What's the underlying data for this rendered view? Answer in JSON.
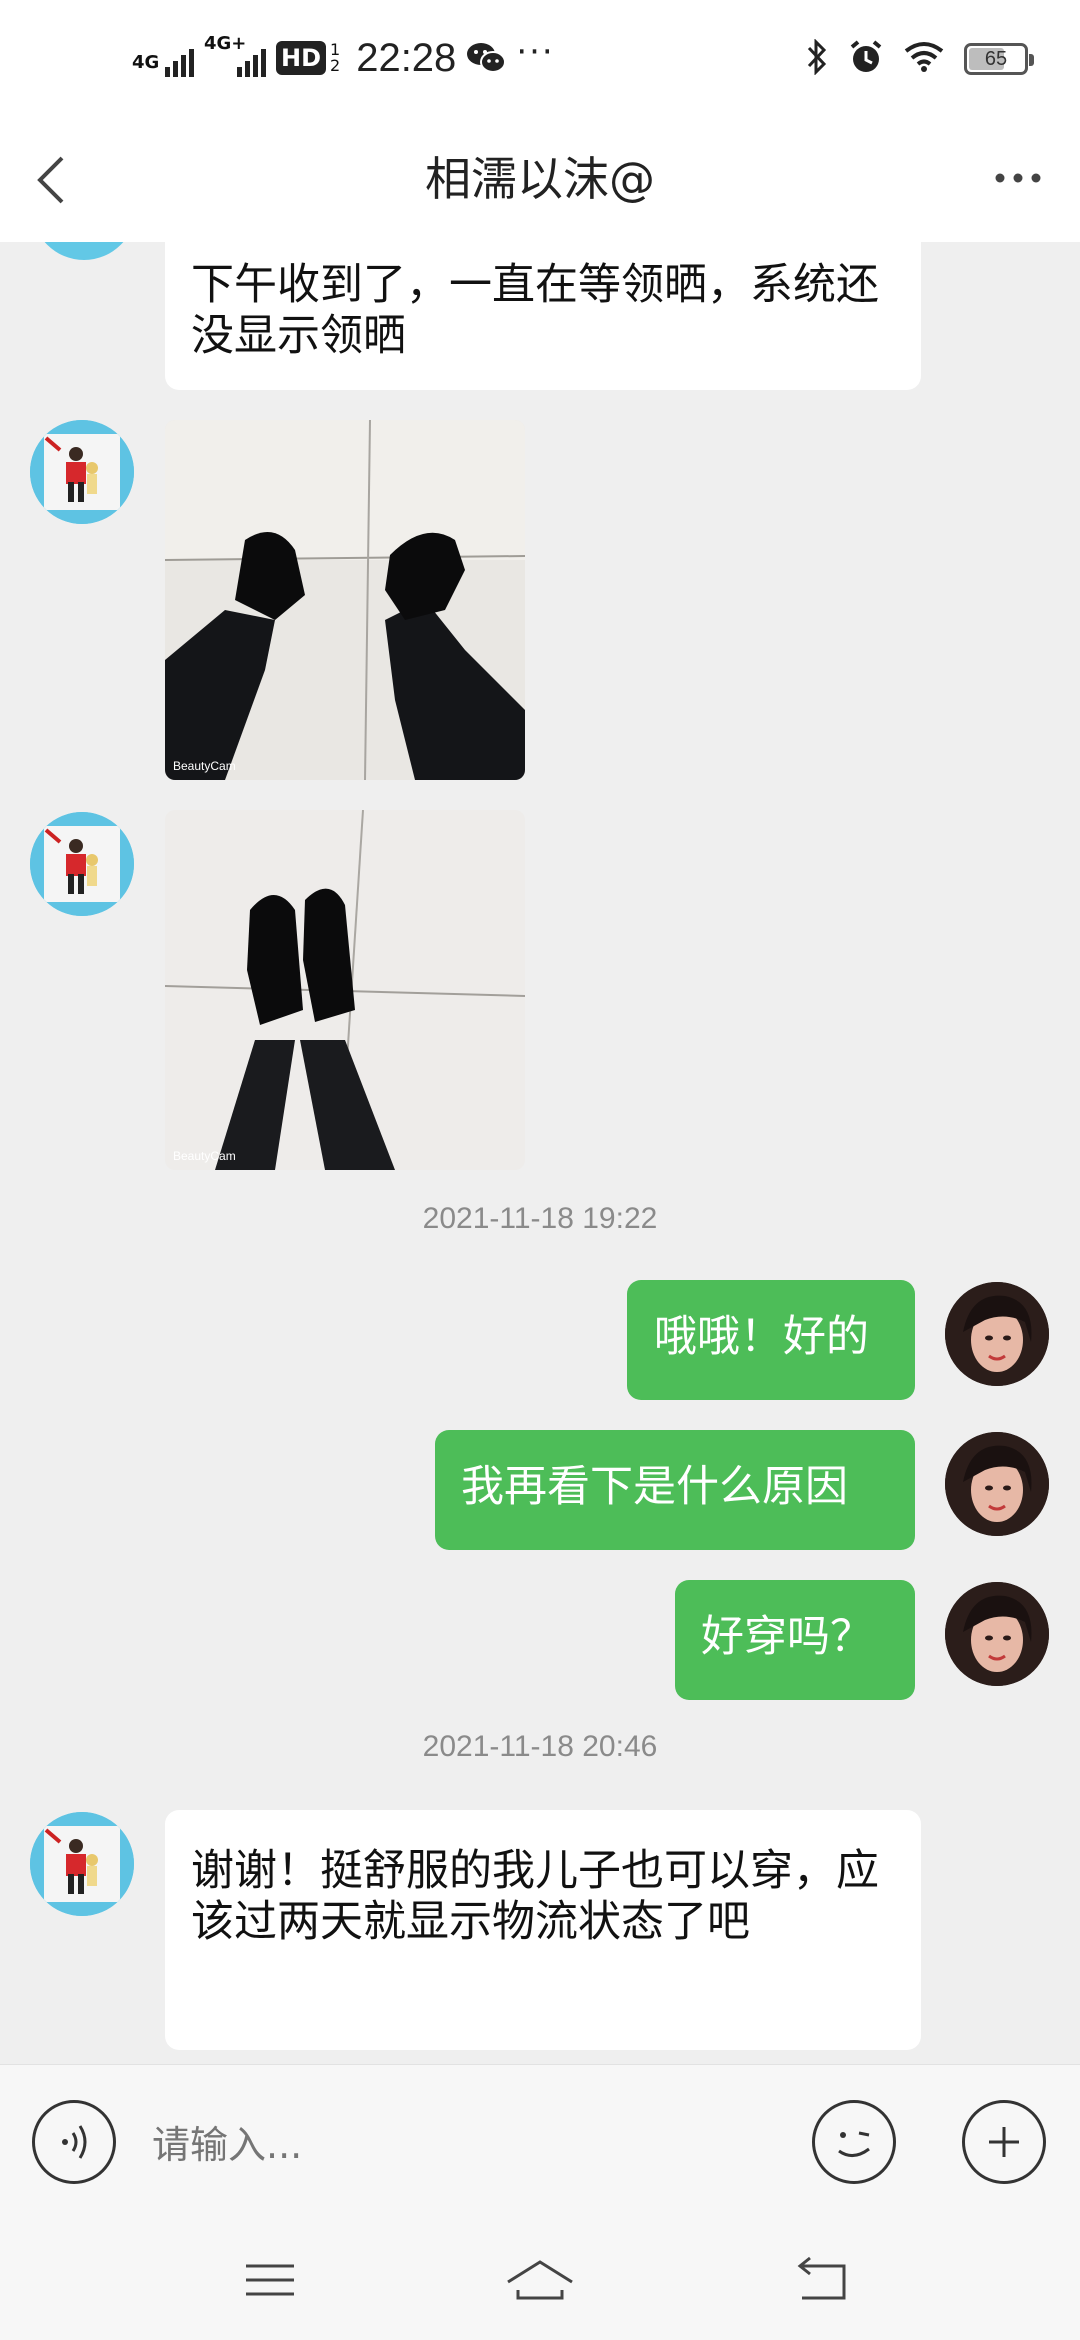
{
  "status_bar": {
    "net1": "4G",
    "net2": "4G+",
    "hd": "HD",
    "hd_sub1": "1",
    "hd_sub2": "2",
    "time": "22:28",
    "more": "···",
    "battery": "65",
    "battery_level": 0.65
  },
  "header": {
    "title": "相濡以沫@"
  },
  "messages": [
    {
      "sender": "other",
      "type": "text",
      "text": "下午收到了，一直在等领晒，系统还没显示领晒"
    },
    {
      "sender": "other",
      "type": "image",
      "watermark": "BeautyCam"
    },
    {
      "sender": "other",
      "type": "image",
      "watermark": "BeautyCam"
    },
    {
      "type": "timestamp",
      "text": "2021-11-18 19:22"
    },
    {
      "sender": "me",
      "type": "text",
      "text": "哦哦！好的"
    },
    {
      "sender": "me",
      "type": "text",
      "text": "我再看下是什么原因"
    },
    {
      "sender": "me",
      "type": "text",
      "text": "好穿吗？"
    },
    {
      "type": "timestamp",
      "text": "2021-11-18 20:46"
    },
    {
      "sender": "other",
      "type": "text",
      "text": "谢谢！挺舒服的我儿子也可以穿，应该过两天就显示物流状态了吧"
    }
  ],
  "input": {
    "placeholder": "请输入..."
  },
  "icons": {
    "voice": "voice-icon",
    "emoji": "emoji-icon",
    "add": "add-icon",
    "back": "back-arrow-icon",
    "more": "more-icon"
  },
  "colors": {
    "my_bubble": "#4dbd58",
    "background": "#efefef"
  }
}
